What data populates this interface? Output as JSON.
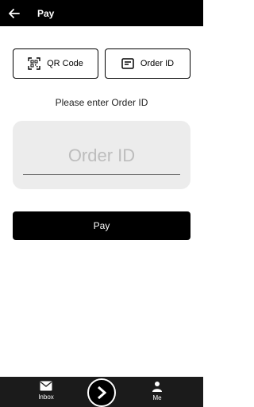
{
  "header": {
    "title": "Pay",
    "back_icon": "arrow-left-icon"
  },
  "tabs": [
    {
      "label": "QR Code",
      "icon": "qr-code-icon"
    },
    {
      "label": "Order ID",
      "icon": "document-icon",
      "active": true
    }
  ],
  "prompt": "Please enter Order ID",
  "order_input": {
    "placeholder": "Order ID",
    "value": ""
  },
  "pay_button": {
    "label": "Pay"
  },
  "bottom_nav": {
    "inbox": {
      "label": "Inbox",
      "icon": "mail-icon"
    },
    "center": {
      "icon": "chevron-right-icon"
    },
    "me": {
      "label": "Me",
      "icon": "person-icon"
    }
  },
  "colors": {
    "primary": "#000000",
    "input_bg": "#ececec",
    "nav_bg": "#1b1b1b"
  }
}
